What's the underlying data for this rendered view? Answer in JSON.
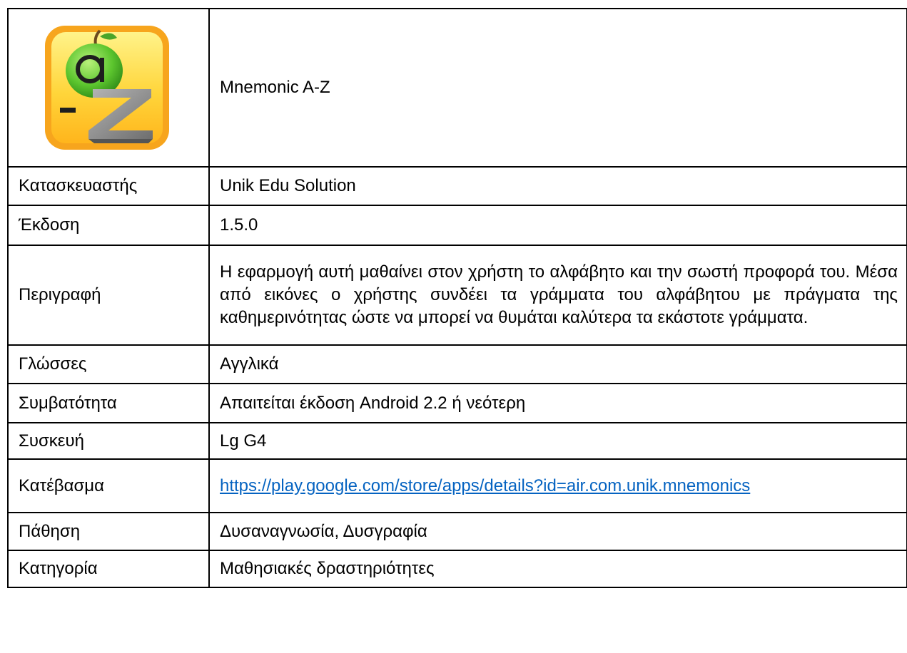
{
  "app": {
    "name": "Mnemonic A-Z",
    "logo": {
      "icon": "a-z-letters-apple-icon",
      "letter_top": "a",
      "letter_bottom": "z",
      "dash": "-",
      "colors": {
        "frame": "#f7a51d",
        "face_top": "#fff38a",
        "face_bottom": "#ffb51c",
        "apple": "#5cc52e",
        "letter_z": "#8f8f8f"
      }
    }
  },
  "rows": [
    {
      "label": "Κατασκευαστής",
      "value": "Unik Edu Solution"
    },
    {
      "label": "Έκδοση",
      "value": "1.5.0"
    },
    {
      "label": "Περιγραφή",
      "value": "Η εφαρμογή αυτή μαθαίνει στον χρήστη το αλφάβητο και την σωστή προφορά του. Μέσα από εικόνες ο χρήστης συνδέει τα γράμματα του αλφάβητου με πράγματα της καθημερινότητας ώστε να μπορεί να θυμάται καλύτερα τα εκάστοτε γράμματα."
    },
    {
      "label": "Γλώσσες",
      "value": "Αγγλικά"
    },
    {
      "label": "Συμβατότητα",
      "value": "Απαιτείται έκδοση Android 2.2 ή νεότερη"
    },
    {
      "label": "Συσκευή",
      "value": "Lg G4"
    },
    {
      "label": "Κατέβασμα",
      "value": "https://play.google.com/store/apps/details?id=air.com.unik.mnemonics"
    },
    {
      "label": "Πάθηση",
      "value": "Δυσαναγνωσία, Δυσγραφία"
    },
    {
      "label": "Κατηγορία",
      "value": "Μαθησιακές δραστηριότητες"
    }
  ],
  "colors": {
    "link": "#0563c1",
    "border": "#000000"
  }
}
